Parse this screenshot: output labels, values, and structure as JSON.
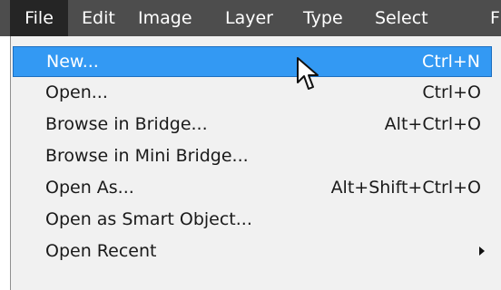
{
  "menubar": {
    "items": [
      {
        "label": "File"
      },
      {
        "label": "Edit"
      },
      {
        "label": "Image"
      },
      {
        "label": "Layer"
      },
      {
        "label": "Type"
      },
      {
        "label": "Select"
      },
      {
        "label": "F"
      }
    ]
  },
  "file_menu": {
    "items": [
      {
        "label": "New...",
        "shortcut": "Ctrl+N"
      },
      {
        "label": "Open...",
        "shortcut": "Ctrl+O"
      },
      {
        "label": "Browse in Bridge...",
        "shortcut": "Alt+Ctrl+O"
      },
      {
        "label": "Browse in Mini Bridge...",
        "shortcut": ""
      },
      {
        "label": "Open As...",
        "shortcut": "Alt+Shift+Ctrl+O"
      },
      {
        "label": "Open as Smart Object...",
        "shortcut": ""
      },
      {
        "label": "Open Recent",
        "shortcut": "",
        "submenu_icon": "chevron-right-icon"
      }
    ]
  },
  "colors": {
    "menubar_bg": "#4d4d4d",
    "active_menu_bg": "#252525",
    "dropdown_bg": "#f1f1f1",
    "highlight_bg": "#3399f3",
    "text": "#1a1a1a",
    "text_on_dark": "#ffffff"
  }
}
